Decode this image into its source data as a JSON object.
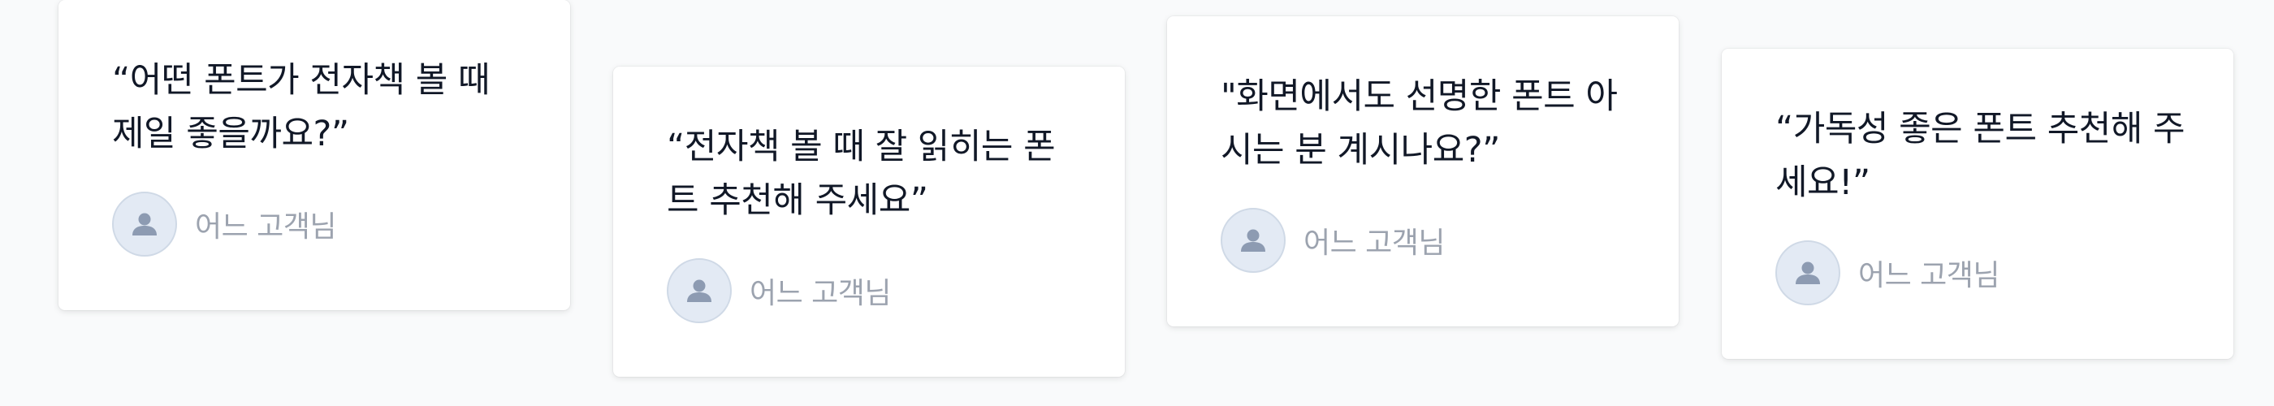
{
  "testimonials": [
    {
      "quote": "“어떤 폰트가 전자책 볼 때 제일 좋을까요?”",
      "author": "어느 고객님"
    },
    {
      "quote": "“전자책 볼 때 잘 읽히는 폰트 추천해 주세요”",
      "author": "어느 고객님"
    },
    {
      "quote": "\"화면에서도 선명한 폰트 아시는 분 계시나요?”",
      "author": "어느 고객님"
    },
    {
      "quote": "“가독성 좋은 폰트 추천해 주세요!”",
      "author": "어느 고객님"
    }
  ],
  "icons": {
    "avatar": "user-icon"
  },
  "colors": {
    "quote_text": "#111827",
    "author_text": "#9ca3af",
    "avatar_bg": "#e3eaf4",
    "avatar_icon": "#8d9bb2"
  }
}
